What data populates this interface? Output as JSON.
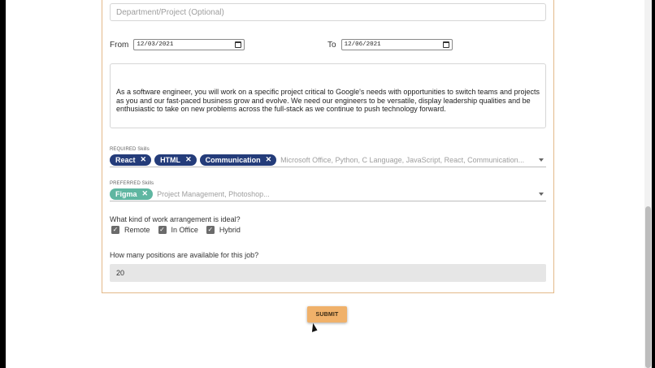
{
  "form": {
    "department": {
      "placeholder": "Department/Project (Optional)",
      "value": ""
    },
    "from": {
      "label": "From",
      "value": "12/03/2021"
    },
    "to": {
      "label": "To",
      "value": "12/06/2021"
    },
    "description": "As a software engineer, you will work on a specific project critical to Google's needs with opportunities to switch teams and projects as you and our fast-paced business grow and evolve. We need our engineers to be versatile, display leadership qualities and be enthusiastic to take on new problems across the full-stack as we continue to push technology forward.",
    "required_skills": {
      "label": "REQUIRED Skills",
      "chips": [
        "React",
        "HTML",
        "Communication"
      ],
      "placeholder": "Microsoft Office, Python, C Language, JavaScript, React, Communication..."
    },
    "preferred_skills": {
      "label": "PREFERRED Skills",
      "chips": [
        "Figma"
      ],
      "placeholder": "Project Management, Photoshop..."
    },
    "work_arrangement": {
      "question": "What kind of work arrangement is ideal?",
      "options": [
        {
          "label": "Remote",
          "checked": true
        },
        {
          "label": "In Office",
          "checked": true
        },
        {
          "label": "Hybrid",
          "checked": true
        }
      ]
    },
    "positions": {
      "question": "How many positions are available for this job?",
      "value": "20"
    },
    "submit_label": "SUBMIT",
    "chip_remove_glyph": "✕",
    "check_glyph": "✓"
  },
  "colors": {
    "required_chip": "#243c7a",
    "preferred_chip": "#5fb6a1",
    "submit_button": "#f0b16a",
    "card_border": "#e3b98a"
  }
}
